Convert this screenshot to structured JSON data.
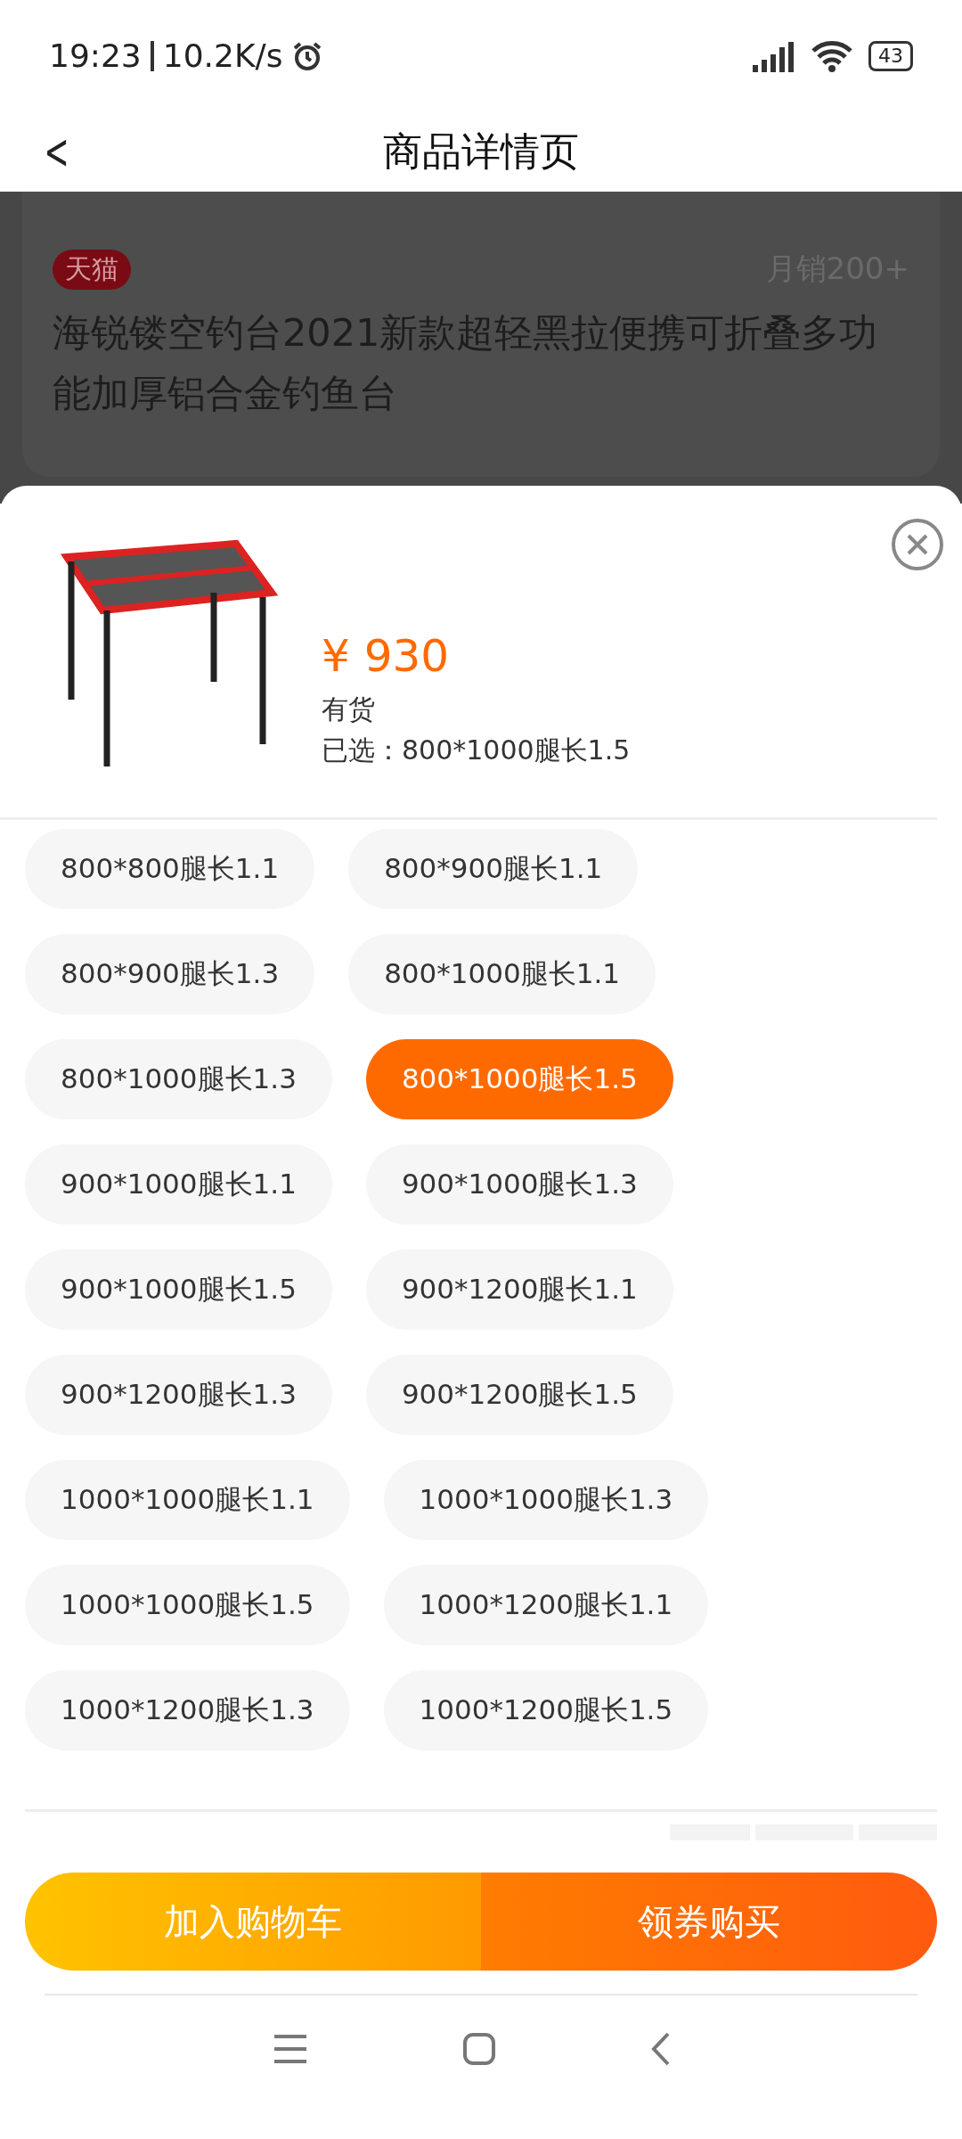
{
  "status_bar": {
    "time": "19:23",
    "speed": "10.2K/s",
    "battery": "43"
  },
  "header": {
    "back": "<",
    "title": "商品详情页"
  },
  "product_card": {
    "badge": "天猫",
    "monthly_sales": "月销200+",
    "title": "海锐镂空钓台2021新款超轻黑拉便携可折叠多功能加厚铝合金钓鱼台"
  },
  "sheet": {
    "price": "¥ 930",
    "stock": "有货",
    "selected_text": "已选：800*1000腿长1.5",
    "options": [
      {
        "label": "800*800腿长1.1",
        "selected": false
      },
      {
        "label": "800*900腿长1.1",
        "selected": false
      },
      {
        "label": "800*900腿长1.3",
        "selected": false
      },
      {
        "label": "800*1000腿长1.1",
        "selected": false
      },
      {
        "label": "800*1000腿长1.3",
        "selected": false
      },
      {
        "label": "800*1000腿长1.5",
        "selected": true
      },
      {
        "label": "900*1000腿长1.1",
        "selected": false
      },
      {
        "label": "900*1000腿长1.3",
        "selected": false
      },
      {
        "label": "900*1000腿长1.5",
        "selected": false
      },
      {
        "label": "900*1200腿长1.1",
        "selected": false
      },
      {
        "label": "900*1200腿长1.3",
        "selected": false
      },
      {
        "label": "900*1200腿长1.5",
        "selected": false
      },
      {
        "label": "1000*1000腿长1.1",
        "selected": false
      },
      {
        "label": "1000*1000腿长1.3",
        "selected": false
      },
      {
        "label": "1000*1000腿长1.5",
        "selected": false
      },
      {
        "label": "1000*1200腿长1.1",
        "selected": false
      },
      {
        "label": "1000*1200腿长1.3",
        "selected": false
      },
      {
        "label": "1000*1200腿长1.5",
        "selected": false
      }
    ],
    "buttons": [
      {
        "label": "加入购物车",
        "kind": "cart"
      },
      {
        "label": "领券购买",
        "kind": "buy"
      }
    ]
  }
}
